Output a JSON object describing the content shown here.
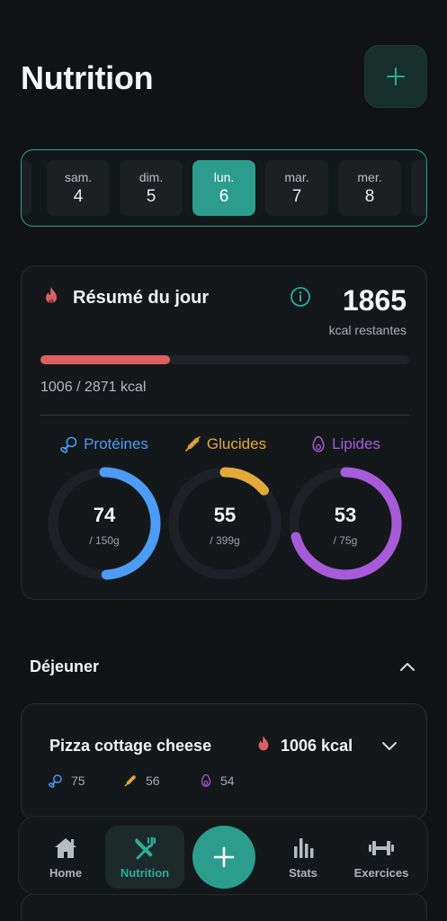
{
  "header": {
    "title": "Nutrition"
  },
  "dates": [
    {
      "name": "sam.",
      "day": "4",
      "active": false
    },
    {
      "name": "dim.",
      "day": "5",
      "active": false
    },
    {
      "name": "lun.",
      "day": "6",
      "active": true
    },
    {
      "name": "mar.",
      "day": "7",
      "active": false
    },
    {
      "name": "mer.",
      "day": "8",
      "active": false
    }
  ],
  "summary": {
    "title": "Résumé du jour",
    "remaining": "1865",
    "remaining_label": "kcal restantes",
    "consumed_text": "1006 / 2871 kcal",
    "progress": 0.35
  },
  "macros": [
    {
      "label": "Protéines",
      "value": "74",
      "goal": "/ 150g",
      "fraction": 0.493,
      "color": "#4c9bf5"
    },
    {
      "label": "Glucides",
      "value": "55",
      "goal": "/ 399g",
      "fraction": 0.138,
      "color": "#e3aa38"
    },
    {
      "label": "Lipides",
      "value": "53",
      "goal": "/ 75g",
      "fraction": 0.707,
      "color": "#a65bd9"
    }
  ],
  "section": {
    "title": "Déjeuner"
  },
  "meal": {
    "name": "Pizza cottage cheese",
    "kcal": "1006 kcal",
    "protein": "75",
    "carbs": "56",
    "fat": "54"
  },
  "nav": {
    "home": "Home",
    "nutrition": "Nutrition",
    "stats": "Stats",
    "exercises": "Exercices"
  },
  "colors": {
    "accent": "#2c9d8c",
    "calorie": "#dc6060"
  }
}
